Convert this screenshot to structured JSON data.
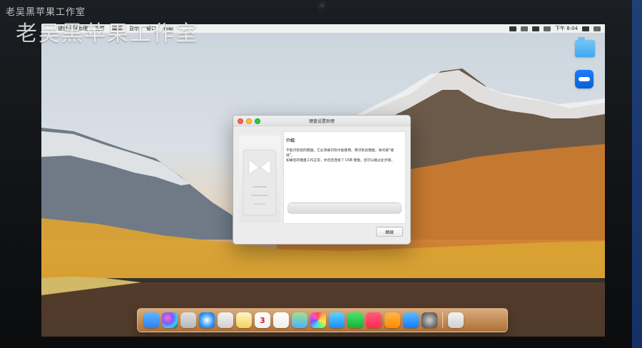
{
  "watermark": {
    "small": "老吴黑苹果工作室",
    "large": "老吴黑苹果工作室"
  },
  "menubar": {
    "items": [
      "键盘设置助理",
      "文件",
      "编辑",
      "显示",
      "窗口",
      "帮助"
    ],
    "time": "下午 8:04"
  },
  "dialog": {
    "title": "键盘设置助理",
    "heading": "介绍",
    "body": "不能识别您的键盘。它必须被识别才能使用。要识别此键盘，请点按“继续”。\n如果您的键盘工作正常，并且您连接了 USB 键盘，您可以跳过此步骤。",
    "button": "继续"
  },
  "dock": {
    "calendar_day": "3"
  },
  "icons": {
    "apple": "apple-icon",
    "finder": "finder-icon",
    "siri": "siri-icon",
    "launchpad": "launchpad-icon",
    "safari": "safari-icon",
    "preview": "preview-icon",
    "notes": "notes-icon",
    "calendar": "calendar-icon",
    "reminders": "reminders-icon",
    "photos": "photos-icon",
    "messages": "messages-icon",
    "facetime": "facetime-icon",
    "music": "music-icon",
    "books": "books-icon",
    "appstore": "app-store-icon",
    "settings": "system-preferences-icon",
    "trash": "trash-icon",
    "folder": "folder-icon",
    "remote": "remote-app-icon"
  },
  "colors": {
    "dock_tint": "#D7873C",
    "wallpaper_accent": "#B36D2C"
  }
}
